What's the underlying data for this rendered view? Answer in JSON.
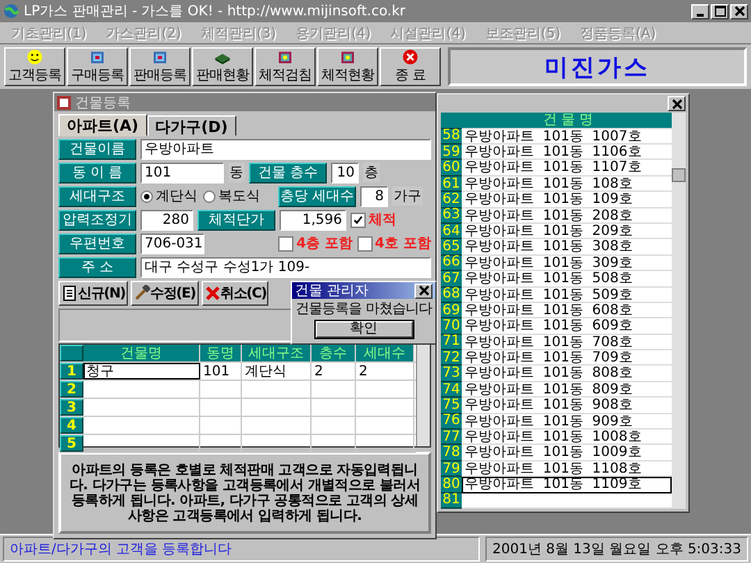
{
  "window": {
    "title": "LP가스 판매관리 - 가스를 OK! - http://www.mijinsoft.co.kr"
  },
  "menu": [
    "기초관리(1)",
    "가스관리(2)",
    "체적관리(3)",
    "용기관리(4)",
    "시설관리(4)",
    "보조관리(5)",
    "정품등록(A)"
  ],
  "toolbar": [
    {
      "label": "고객등록",
      "kind": "smiley"
    },
    {
      "label": "구매등록",
      "kind": "folder"
    },
    {
      "label": "판매등록",
      "kind": "folder"
    },
    {
      "label": "판매현황",
      "kind": "book"
    },
    {
      "label": "체적검침",
      "kind": "box"
    },
    {
      "label": "체적현황",
      "kind": "box"
    },
    {
      "label": "종 료",
      "kind": "exit"
    }
  ],
  "brand": "미진가스",
  "form": {
    "title": "건물등록",
    "tabs": [
      {
        "label": "아파트(A)",
        "selected": true
      },
      {
        "label": "다가구(D)",
        "selected": false
      }
    ],
    "building_name": {
      "label": "건물이름",
      "value": "우방아파트"
    },
    "dong": {
      "label": "동 이 름",
      "value": "101",
      "unit": "동"
    },
    "floors": {
      "label": "건물 층수",
      "value": "10",
      "unit": "층"
    },
    "structure": {
      "label": "세대구조",
      "options": [
        {
          "label": "계단식",
          "selected": true
        },
        {
          "label": "복도식",
          "selected": false
        }
      ]
    },
    "households": {
      "label": "층당 세대수",
      "value": "8",
      "unit": "가구"
    },
    "regulator": {
      "label": "압력조정기",
      "value": "280"
    },
    "unit_price": {
      "label": "체적단가",
      "value": "1,596"
    },
    "volume": {
      "label": "체적",
      "checked": true
    },
    "postal": {
      "label": "우편번호",
      "value": "706-031"
    },
    "includes": [
      {
        "label": "4층 포함",
        "checked": false
      },
      {
        "label": "4호 포함",
        "checked": false
      }
    ],
    "address": {
      "label": "주 소",
      "value": "대구 수성구 수성1가 109-"
    },
    "buttons": [
      {
        "label": "신규(N)",
        "kind": "new"
      },
      {
        "label": "수정(E)",
        "kind": "edit"
      },
      {
        "label": "취소(C)",
        "kind": "cancel"
      }
    ],
    "grid": {
      "columns": [
        "건물명",
        "동명",
        "세대구조",
        "층수",
        "세대수"
      ],
      "rows": [
        {
          "number": "1",
          "cells": [
            "청구",
            "101",
            "계단식",
            "2",
            "2"
          ]
        },
        {
          "number": "2"
        },
        {
          "number": "3"
        },
        {
          "number": "4"
        },
        {
          "number": "5"
        }
      ]
    },
    "note": "아파트의 등록은 호별로 체적판매 고객으로 자동입력됩니다. 다가구는 등록사항을 고객등록에서 개별적으로 불러서 등록하게 됩니다. 아파트, 다가구 공통적으로 고객의 상세사항은 고객등록에서 입력하게 됩니다."
  },
  "list": {
    "header": "건 물 명",
    "rows": [
      {
        "number": "58",
        "name": "우방아파트  101동  1007호",
        "selected": false
      },
      {
        "number": "59",
        "name": "우방아파트  101동  1106호",
        "selected": false
      },
      {
        "number": "60",
        "name": "우방아파트  101동  1107호",
        "selected": false
      },
      {
        "number": "61",
        "name": "우방아파트  101동  108호",
        "selected": false
      },
      {
        "number": "62",
        "name": "우방아파트  101동  109호",
        "selected": false
      },
      {
        "number": "63",
        "name": "우방아파트  101동  208호",
        "selected": false
      },
      {
        "number": "64",
        "name": "우방아파트  101동  209호",
        "selected": false
      },
      {
        "number": "65",
        "name": "우방아파트  101동  308호",
        "selected": false
      },
      {
        "number": "66",
        "name": "우방아파트  101동  309호",
        "selected": false
      },
      {
        "number": "67",
        "name": "우방아파트  101동  508호",
        "selected": false
      },
      {
        "number": "68",
        "name": "우방아파트  101동  509호",
        "selected": false
      },
      {
        "number": "69",
        "name": "우방아파트  101동  608호",
        "selected": false
      },
      {
        "number": "70",
        "name": "우방아파트  101동  609호",
        "selected": false
      },
      {
        "number": "71",
        "name": "우방아파트  101동  708호",
        "selected": false
      },
      {
        "number": "72",
        "name": "우방아파트  101동  709호",
        "selected": false
      },
      {
        "number": "73",
        "name": "우방아파트  101동  808호",
        "selected": false
      },
      {
        "number": "74",
        "name": "우방아파트  101동  809호",
        "selected": false
      },
      {
        "number": "75",
        "name": "우방아파트  101동  908호",
        "selected": false
      },
      {
        "number": "76",
        "name": "우방아파트  101동  909호",
        "selected": false
      },
      {
        "number": "77",
        "name": "우방아파트  101동  1008호",
        "selected": false
      },
      {
        "number": "78",
        "name": "우방아파트  101동  1009호",
        "selected": false
      },
      {
        "number": "79",
        "name": "우방아파트  101동  1108호",
        "selected": false
      },
      {
        "number": "80",
        "name": "우방아파트  101동  1109호",
        "selected": true
      },
      {
        "number": "81",
        "selected": false
      }
    ]
  },
  "dialog": {
    "title": "건물 관리자",
    "message": "건물등록을 마쳤습니다",
    "button": "확인"
  },
  "status_bar": {
    "message": "아파트/다가구의 고객을 등록합니다",
    "datetime": "2001년 8월 13일 월요일 오후 5:03:33"
  }
}
